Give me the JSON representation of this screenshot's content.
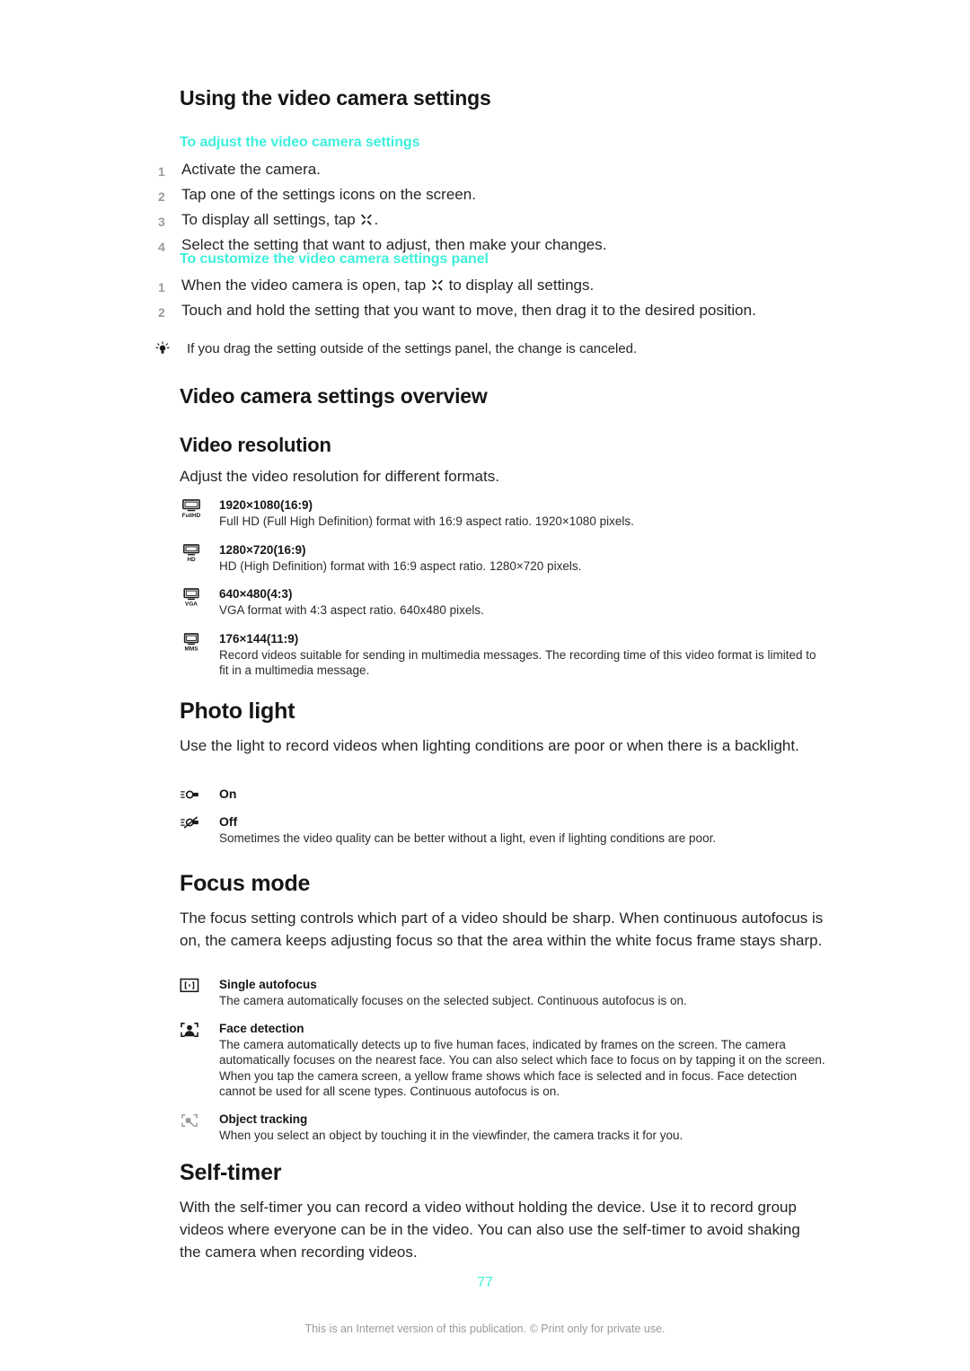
{
  "document": {
    "page_number": "77",
    "footer_note": "This is an Internet version of this publication. © Print only for private use.",
    "accent_color": "#3FF0DC"
  },
  "sections": {
    "using_settings": {
      "heading": "Using the video camera settings",
      "proc_a": {
        "subheading": "To adjust the video camera settings",
        "steps": [
          {
            "num": "1",
            "pre": "Activate the camera.",
            "icon": "",
            "post": ""
          },
          {
            "num": "2",
            "pre": "Tap one of the settings icons on the screen.",
            "icon": "",
            "post": ""
          },
          {
            "num": "3",
            "pre": "To display all settings, tap ",
            "icon": "settings-tool-icon",
            "post": "."
          },
          {
            "num": "4",
            "pre": "Select the setting that want to adjust, then make your changes.",
            "icon": "",
            "post": ""
          }
        ]
      },
      "proc_b": {
        "subheading": "To customize the video camera settings panel",
        "steps": [
          {
            "num": "1",
            "pre": "When the video camera is open, tap ",
            "icon": "settings-tool-icon",
            "post": " to display all settings."
          },
          {
            "num": "2",
            "pre": "Touch and hold the setting that you want to move, then drag it to the desired position.",
            "icon": "",
            "post": ""
          }
        ]
      },
      "tip": {
        "icon": "lightbulb-icon",
        "text": "If you drag the setting outside of the settings panel, the change is canceled."
      }
    },
    "overview": {
      "heading": "Video camera settings overview"
    },
    "video_resolution": {
      "heading": "Video resolution",
      "intro": "Adjust the video resolution for different formats.",
      "options": [
        {
          "icon": "screen-fullhd-icon",
          "icon_label": "FullHD",
          "title": "1920×1080(16:9)",
          "desc": "Full HD (Full High Definition) format with 16:9 aspect ratio. 1920×1080 pixels."
        },
        {
          "icon": "screen-hd-icon",
          "icon_label": "HD",
          "title": "1280×720(16:9)",
          "desc": "HD (High Definition) format with 16:9 aspect ratio. 1280×720 pixels."
        },
        {
          "icon": "screen-vga-icon",
          "icon_label": "VGA",
          "title": "640×480(4:3)",
          "desc": "VGA format with 4:3 aspect ratio. 640x480 pixels."
        },
        {
          "icon": "screen-mms-icon",
          "icon_label": "MMS",
          "title": "176×144(11:9)",
          "desc": "Record videos suitable for sending in multimedia messages. The recording time of this video format is limited to fit in a multimedia message."
        }
      ]
    },
    "photo_light": {
      "heading": "Photo light",
      "intro": "Use the light to record videos when lighting conditions are poor or when there is a backlight.",
      "options": [
        {
          "icon": "flash-on-icon",
          "title": "On",
          "desc": ""
        },
        {
          "icon": "flash-off-icon",
          "title": "Off",
          "desc": "Sometimes the video quality can be better without a light, even if lighting conditions are poor."
        }
      ]
    },
    "focus_mode": {
      "heading": "Focus mode",
      "intro": "The focus setting controls which part of a video should be sharp. When continuous autofocus is on, the camera keeps adjusting focus so that the area within the white focus frame stays sharp.",
      "options": [
        {
          "icon": "focus-frame-icon",
          "title": "Single autofocus",
          "desc": "The camera automatically focuses on the selected subject. Continuous autofocus is on."
        },
        {
          "icon": "face-detection-icon",
          "title": "Face detection",
          "desc": "The camera automatically detects up to five human faces, indicated by frames on the screen. The camera automatically focuses on the nearest face. You can also select which face to focus on by tapping it on the screen. When you tap the camera screen, a yellow frame shows which face is selected and in focus. Face detection cannot be used for all scene types. Continuous autofocus is on."
        },
        {
          "icon": "object-tracking-icon",
          "title": "Object tracking",
          "desc": "When you select an object by touching it in the viewfinder, the camera tracks it for you."
        }
      ]
    },
    "self_timer": {
      "heading": "Self-timer",
      "intro": "With the self-timer you can record a video without holding the device. Use it to record group videos where everyone can be in the video. You can also use the self-timer to avoid shaking the camera when recording videos."
    }
  }
}
